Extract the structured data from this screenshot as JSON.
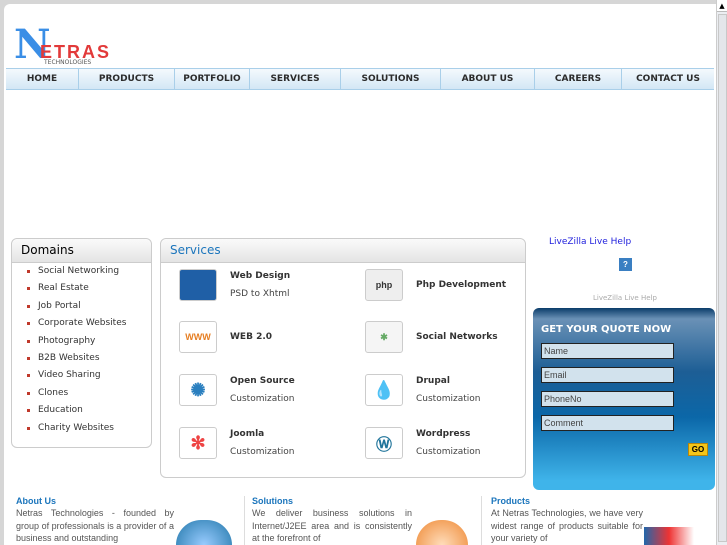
{
  "logo": {
    "main": "N",
    "rest": "ETRAS",
    "sub": "TECHNOLOGIES"
  },
  "nav": [
    "HOME",
    "PRODUCTS",
    "PORTFOLIO",
    "SERVICES",
    "SOLUTIONS",
    "ABOUT US",
    "CAREERS",
    "CONTACT US"
  ],
  "domains": {
    "title": "Domains",
    "items": [
      "Social Networking",
      "Real Estate",
      "Job Portal",
      "Corporate Websites",
      "Photography",
      "B2B Websites",
      "Video Sharing",
      "Clones",
      "Education",
      "Charity Websites"
    ]
  },
  "services": {
    "title": "Services",
    "items": [
      {
        "name": "Web Design",
        "sub": "PSD to Xhtml",
        "icon": "web-design-icon"
      },
      {
        "name": "Php Development",
        "sub": "",
        "icon": "php-icon"
      },
      {
        "name": "WEB 2.0",
        "sub": "",
        "icon": "www-icon"
      },
      {
        "name": "Social Networks",
        "sub": "",
        "icon": "social-networks-icon"
      },
      {
        "name": "Open Source",
        "sub": "Customization",
        "icon": "open-source-icon"
      },
      {
        "name": "Drupal",
        "sub": "Customization",
        "icon": "drupal-icon"
      },
      {
        "name": "Joomla",
        "sub": "Customization",
        "icon": "joomla-icon"
      },
      {
        "name": "Wordpress",
        "sub": "Customization",
        "icon": "wordpress-icon"
      }
    ]
  },
  "livehelp": {
    "link": "LiveZilla Live Help",
    "caption": "LiveZilla Live Help",
    "icon": "?"
  },
  "quote": {
    "title": "GET YOUR QUOTE NOW",
    "fields": [
      "Name",
      "Email",
      "PhoneNo",
      "Comment"
    ],
    "go": "GO"
  },
  "footer": [
    {
      "title": "About Us",
      "text": "Netras Technologies - founded by group of professionals is a provider of a business and outstanding"
    },
    {
      "title": "Solutions",
      "text": "We deliver business solutions in Internet/J2EE area and is consistently at the forefront of"
    },
    {
      "title": "Products",
      "text": "At Netras Technologies, we have very widest range of products suitable for your variety of"
    }
  ]
}
